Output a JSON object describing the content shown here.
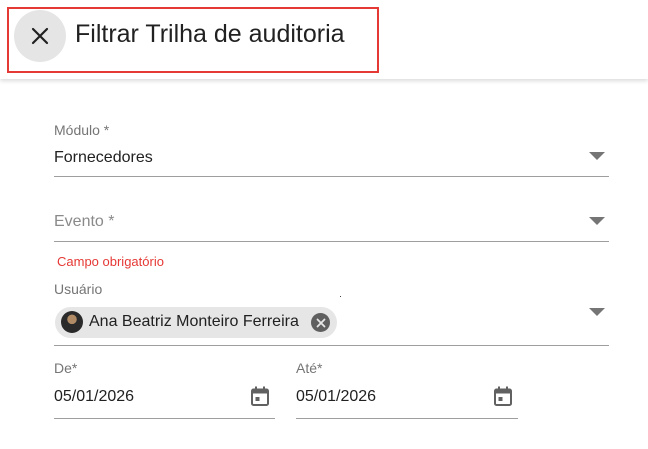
{
  "header": {
    "title": "Filtrar Trilha de auditoria",
    "close_icon": "close-icon"
  },
  "form": {
    "modulo": {
      "label": "Módulo *",
      "value": "Fornecedores"
    },
    "evento": {
      "label": "Evento *",
      "value": "",
      "placeholder": "Evento *",
      "error": "Campo obrigatório"
    },
    "usuario": {
      "label": "Usuário",
      "chips": [
        {
          "label": "Ana Beatriz Monteiro Ferreira"
        }
      ]
    },
    "de": {
      "label": "De*",
      "value": "05/01/2026",
      "icon": "calendar-icon"
    },
    "ate": {
      "label": "Até*",
      "value": "05/01/2026",
      "icon": "calendar-icon"
    }
  },
  "colors": {
    "highlight": "#e53935",
    "error": "#e53935",
    "text": "#212121",
    "label": "#757575"
  }
}
